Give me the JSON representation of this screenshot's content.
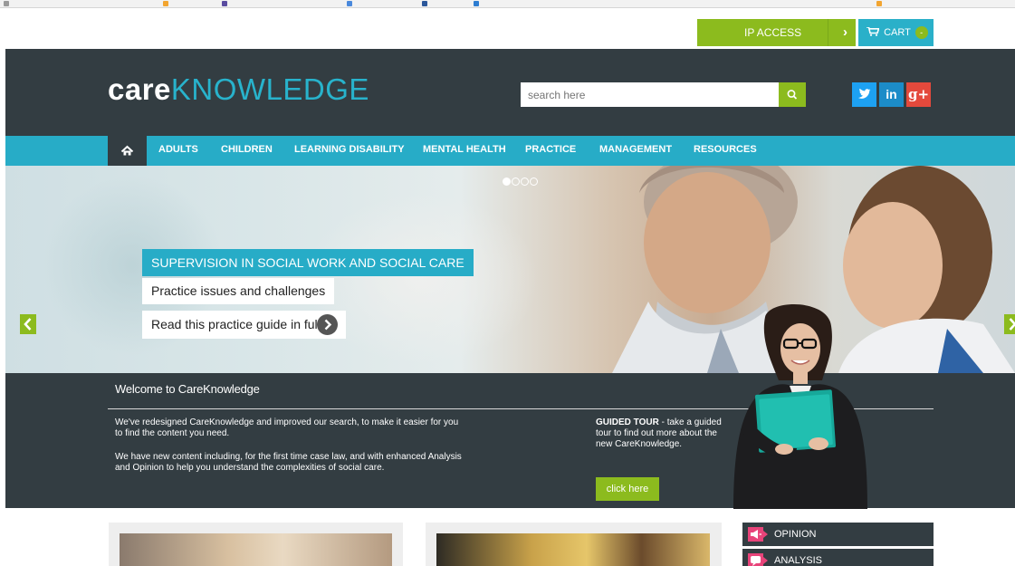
{
  "utility": {
    "ip_access_label": "IP ACCESS",
    "cart_label": "CART",
    "cart_count": "-"
  },
  "header": {
    "logo_care": "care",
    "logo_knowledge": "KNOWLEDGE",
    "search_placeholder": "search here",
    "social": {
      "twitter": "t",
      "linkedin": "in",
      "googleplus": "g+"
    }
  },
  "nav": {
    "items": [
      {
        "label": "ADULTS"
      },
      {
        "label": "CHILDREN"
      },
      {
        "label": "LEARNING DISABILITY"
      },
      {
        "label": "MENTAL HEALTH"
      },
      {
        "label": "PRACTICE"
      },
      {
        "label": "MANAGEMENT"
      },
      {
        "label": "RESOURCES"
      }
    ]
  },
  "hero": {
    "title": "SUPERVISION IN SOCIAL WORK AND SOCIAL CARE",
    "subtitle": "Practice issues and challenges",
    "cta": "Read this practice guide in full",
    "slide_count": 4,
    "active_slide": 1
  },
  "welcome": {
    "heading": "Welcome to CareKnowledge",
    "p1": "We've redesigned CareKnowledge and improved our search, to make it easier for you to find the content you need.",
    "p2": "We have new content including, for the first time case law, and with enhanced Analysis and Opinion to help you understand the complexities of social care.",
    "tour_bold": "GUIDED TOUR",
    "tour_text": " - take a guided tour to find out more about the new CareKnowledge.",
    "button": "click here"
  },
  "sidebar": {
    "items": [
      {
        "label": "OPINION",
        "icon": "megaphone-icon"
      },
      {
        "label": "ANALYSIS",
        "icon": "speech-bubble-icon"
      }
    ]
  },
  "colors": {
    "dark": "#333d42",
    "teal": "#27acc7",
    "green": "#8cbb1e",
    "pink": "#e8447a"
  }
}
